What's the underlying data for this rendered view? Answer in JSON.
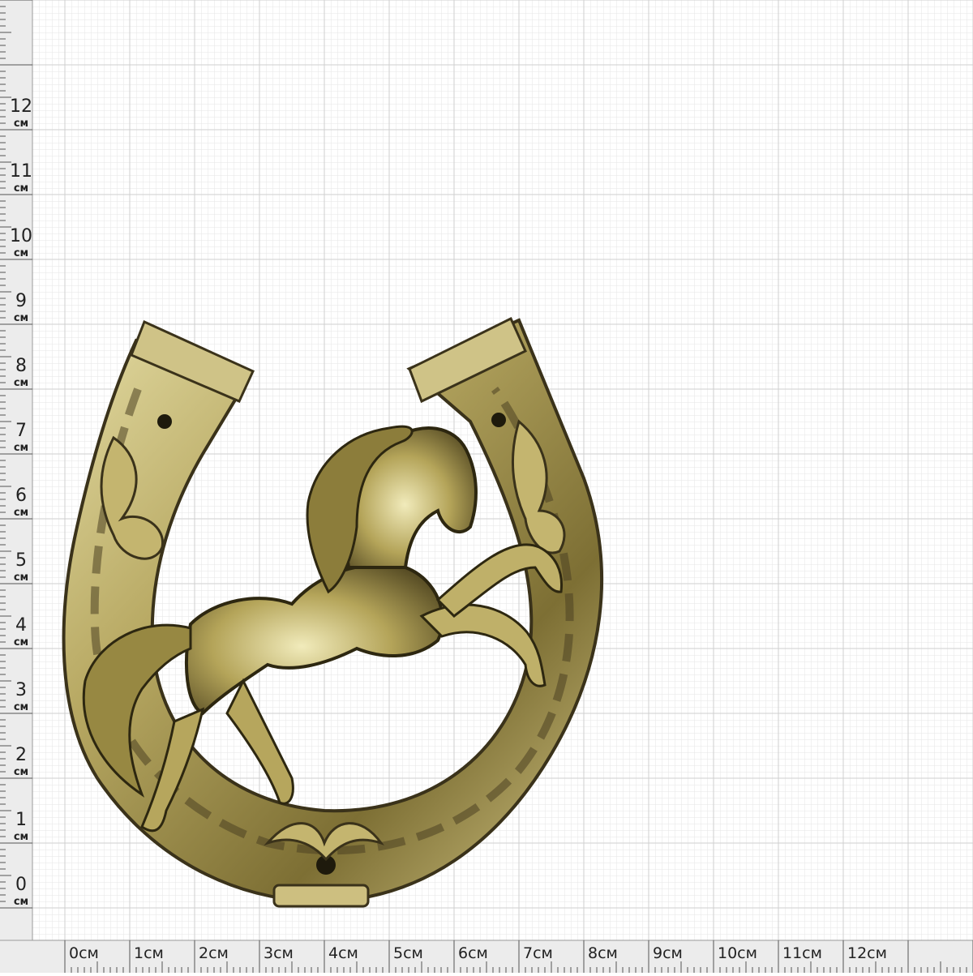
{
  "ruler": {
    "unit": "см",
    "vertical_labels": [
      "12",
      "11",
      "10",
      "9",
      "8",
      "7",
      "6",
      "5",
      "4",
      "3",
      "2",
      "1",
      "0"
    ],
    "horizontal_labels": [
      "0см",
      "1см",
      "2см",
      "3см",
      "4см",
      "5см",
      "6см",
      "7см",
      "8см",
      "9см",
      "10см",
      "11см",
      "12см"
    ]
  },
  "object": {
    "name": "brass horseshoe with rearing horse",
    "colors": {
      "brass_light": "#d8cf96",
      "brass_mid": "#9a8c48",
      "brass_dark": "#3a321a"
    }
  }
}
